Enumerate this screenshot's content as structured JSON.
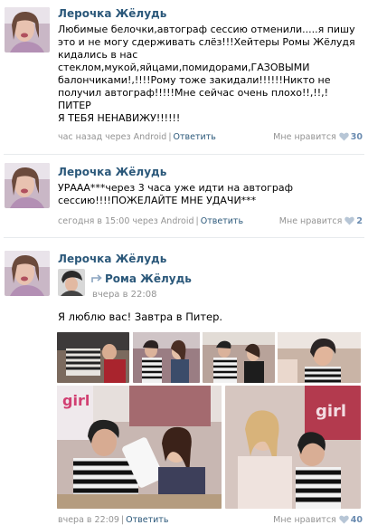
{
  "posts": [
    {
      "author": "Лерочка Жёлудь",
      "text": "Любимые белочки,автограф сессию отменили.....я пишу\nэто и не могу сдерживать слёз!!!Хейтеры Ромы Жёлудя\nкидались в нас\nстеклом,мукой,яйцами,помидорами,ГАЗОВЫМИ\nбалончиками!,!!!!Рому тоже закидали!!!!!!Никто не\nполучил автограф!!!!!Мне сейчас очень плохо!!,!!,!ПИТЕР\nЯ ТЕБЯ НЕНАВИЖУ!!!!!!",
      "time": "час назад через Android",
      "reply": "Ответить",
      "likes_label": "Мне нравится",
      "likes_count": "30"
    },
    {
      "author": "Лерочка Жёлудь",
      "text": "УРААА***через 3 часа уже идти на автограф\nсессию!!!!ПОЖЕЛАЙТЕ МНЕ УДАЧИ***",
      "time": "сегодня в 15:00 через Android",
      "reply": "Ответить",
      "likes_label": "Мне нравится",
      "likes_count": "2"
    },
    {
      "author": "Лерочка Жёлудь",
      "repost": {
        "author": "Рома Жёлудь",
        "time": "вчера в 22:08",
        "text": "Я люблю вас! Завтра в Питер."
      },
      "time": "вчера в 22:09",
      "reply": "Ответить",
      "likes_label": "Мне нравится",
      "likes_count": "40"
    }
  ],
  "colors": {
    "link": "#2b587a",
    "meta": "#939393",
    "like_heart": "#b7c6d6"
  },
  "icons": [
    "heart-icon",
    "repost-arrow-icon"
  ]
}
